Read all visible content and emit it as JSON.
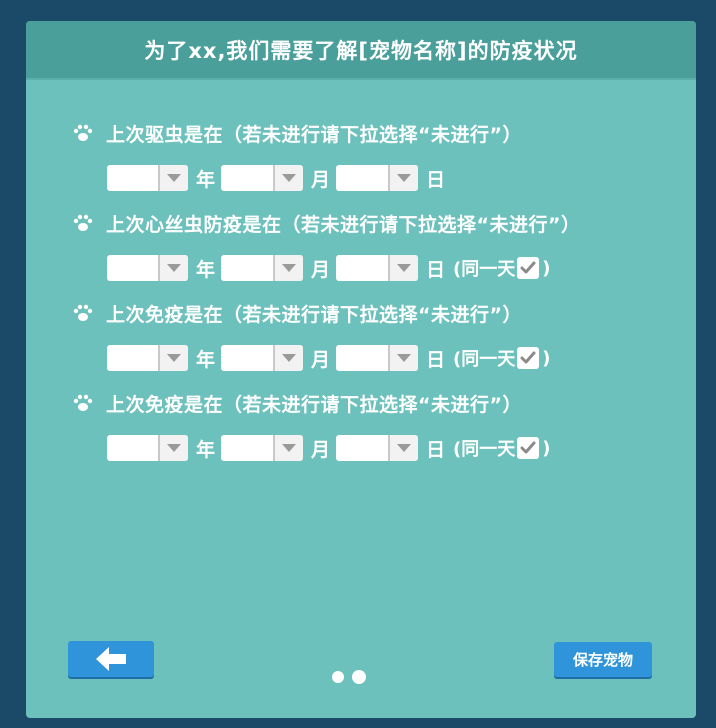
{
  "header": {
    "title": "为了xx,我们需要了解[宠物名称]的防疫状况"
  },
  "sections": [
    {
      "question": "上次驱虫是在（若未进行请下拉选择“未进行”）",
      "year_label": "年",
      "month_label": "月",
      "day_label": "日",
      "same_day_label": null,
      "same_day_checked": false
    },
    {
      "question": "上次心丝虫防疫是在（若未进行请下拉选择“未进行”）",
      "year_label": "年",
      "month_label": "月",
      "day_label": "日",
      "same_day_label": "(同一天",
      "same_day_close": ")",
      "same_day_checked": true
    },
    {
      "question": "上次免疫是在（若未进行请下拉选择“未进行”）",
      "year_label": "年",
      "month_label": "月",
      "day_label": "日",
      "same_day_label": "(同一天",
      "same_day_close": ")",
      "same_day_checked": true
    },
    {
      "question": "上次免疫是在（若未进行请下拉选择“未进行”）",
      "year_label": "年",
      "month_label": "月",
      "day_label": "日",
      "same_day_label": "(同一天",
      "same_day_close": ")",
      "same_day_checked": true
    }
  ],
  "selects": {
    "year_value": "",
    "month_value": "",
    "day_value": ""
  },
  "footer": {
    "save_label": "保存宠物",
    "back_icon": "arrow-left-icon",
    "pager_pages": 2,
    "pager_active": 2
  },
  "colors": {
    "background": "#1b4a68",
    "panel": "#6dc1bd",
    "header": "#4a9f9a",
    "button": "#2f94d9"
  }
}
